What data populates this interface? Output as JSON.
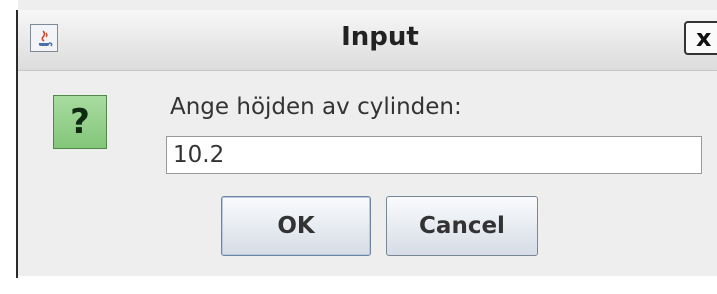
{
  "window": {
    "title": "Input",
    "close_label": "x"
  },
  "dialog": {
    "icon_symbol": "?",
    "prompt": "Ange höjden av cylinden:",
    "input_value": "10.2",
    "ok_label": "OK",
    "cancel_label": "Cancel"
  },
  "colors": {
    "question_icon_bg": "#8fcf86",
    "dialog_bg": "#eeeeee"
  },
  "icons": {
    "title_icon": "java-cup-icon",
    "question_icon": "question-icon",
    "close_icon": "close-icon"
  }
}
